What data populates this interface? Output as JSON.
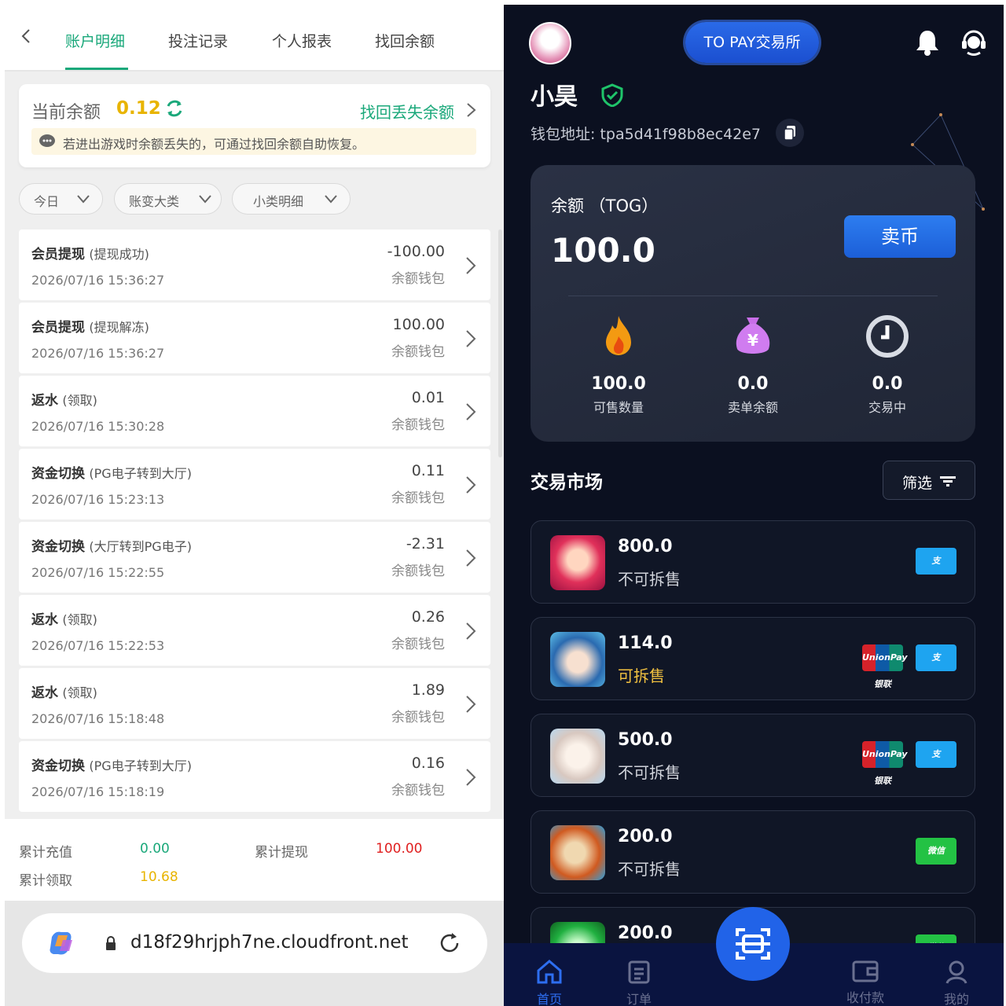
{
  "left": {
    "tabs": [
      "账户明细",
      "投注记录",
      "个人报表",
      "找回余额"
    ],
    "balance": {
      "label": "当前余额",
      "value": "0.12",
      "recover_link": "找回丢失余额",
      "notice": "若进出游戏时余额丢失的，可通过找回余额自助恢复。"
    },
    "filters": [
      "今日",
      "账变大类",
      "小类明细"
    ],
    "records": [
      {
        "title": "会员提现",
        "sub": "(提现成功)",
        "time": "2026/07/16 15:36:27",
        "amount": "-100.00",
        "wallet": "余额钱包"
      },
      {
        "title": "会员提现",
        "sub": "(提现解冻)",
        "time": "2026/07/16 15:36:27",
        "amount": "100.00",
        "wallet": "余额钱包"
      },
      {
        "title": "返水",
        "sub": "(领取)",
        "time": "2026/07/16 15:30:28",
        "amount": "0.01",
        "wallet": "余额钱包"
      },
      {
        "title": "资金切换",
        "sub": "(PG电子转到大厅)",
        "time": "2026/07/16 15:23:13",
        "amount": "0.11",
        "wallet": "余额钱包"
      },
      {
        "title": "资金切换",
        "sub": "(大厅转到PG电子)",
        "time": "2026/07/16 15:22:55",
        "amount": "-2.31",
        "wallet": "余额钱包"
      },
      {
        "title": "返水",
        "sub": "(领取)",
        "time": "2026/07/16 15:22:53",
        "amount": "0.26",
        "wallet": "余额钱包"
      },
      {
        "title": "返水",
        "sub": "(领取)",
        "time": "2026/07/16 15:18:48",
        "amount": "1.89",
        "wallet": "余额钱包"
      },
      {
        "title": "资金切换",
        "sub": "(PG电子转到大厅)",
        "time": "2026/07/16 15:18:19",
        "amount": "0.16",
        "wallet": "余额钱包"
      }
    ],
    "totals": {
      "recharge_label": "累计充值",
      "recharge_value": "0.00",
      "withdraw_label": "累计提现",
      "withdraw_value": "100.00",
      "claim_label": "累计领取",
      "claim_value": "10.68"
    },
    "browser": {
      "url": "d18f29hrjph7ne.cloudfront.net"
    }
  },
  "right": {
    "header": {
      "exchange_button": "TO PAY交易所"
    },
    "user": {
      "name": "小昊",
      "wallet_label": "钱包地址: tpa5d41f98b8ec42e7"
    },
    "balance": {
      "label": "余额 （TOG）",
      "value": "100.0",
      "sell_button": "卖币",
      "stats": [
        {
          "value": "100.0",
          "label": "可售数量",
          "icon": "flame-icon"
        },
        {
          "value": "0.0",
          "label": "卖单余额",
          "icon": "money-bag-icon"
        },
        {
          "value": "0.0",
          "label": "交易中",
          "icon": "clock-icon"
        }
      ]
    },
    "market": {
      "title": "交易市场",
      "filter_button": "筛选",
      "items": [
        {
          "amount": "800.0",
          "status": "不可拆售",
          "payments": [
            "alipay"
          ]
        },
        {
          "amount": "114.0",
          "status": "可拆售",
          "payments": [
            "unionpay",
            "alipay"
          ]
        },
        {
          "amount": "500.0",
          "status": "不可拆售",
          "payments": [
            "unionpay",
            "alipay"
          ]
        },
        {
          "amount": "200.0",
          "status": "不可拆售",
          "payments": [
            "wechat"
          ]
        },
        {
          "amount": "200.0",
          "status": "",
          "payments": [
            "wechat"
          ]
        }
      ],
      "payment_labels": {
        "alipay": "支",
        "unionpay": "UnionPay 银联",
        "wechat": "微信"
      }
    },
    "tabbar": [
      "首页",
      "订单",
      "收付款",
      "我的"
    ],
    "colors": {
      "accent_green": "#1aa87a",
      "balance_yellow": "#e8b400",
      "withdraw_red": "#e02020",
      "primary_blue": "#2163e8",
      "split_yellow": "#f0c040"
    }
  }
}
